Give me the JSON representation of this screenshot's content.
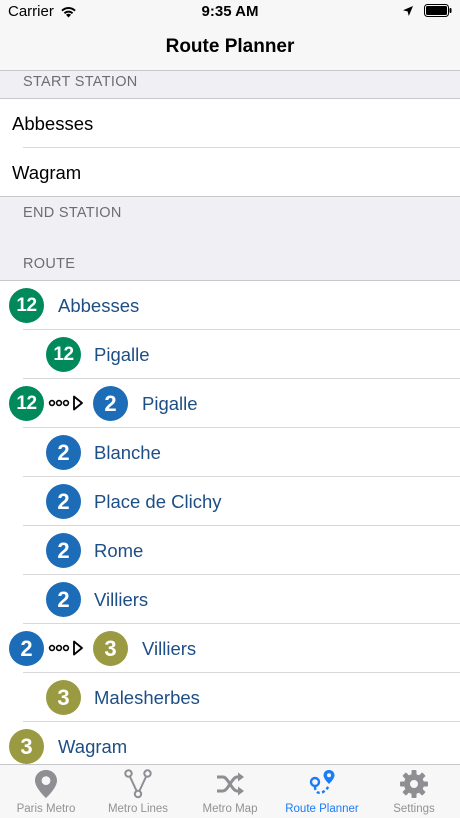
{
  "status_bar": {
    "carrier": "Carrier",
    "time": "9:35 AM"
  },
  "nav": {
    "title": "Route Planner"
  },
  "start_section": {
    "header": "START STATION",
    "stations": [
      "Abbesses",
      "Wagram"
    ]
  },
  "end_section": {
    "header": "END STATION"
  },
  "route_section": {
    "header": "ROUTE",
    "steps": [
      {
        "line": "12",
        "to_line": null,
        "station": "Abbesses"
      },
      {
        "line": "12",
        "to_line": null,
        "station": "Pigalle"
      },
      {
        "line": "12",
        "to_line": "2",
        "station": "Pigalle"
      },
      {
        "line": "2",
        "to_line": null,
        "station": "Blanche"
      },
      {
        "line": "2",
        "to_line": null,
        "station": "Place de Clichy"
      },
      {
        "line": "2",
        "to_line": null,
        "station": "Rome"
      },
      {
        "line": "2",
        "to_line": null,
        "station": "Villiers"
      },
      {
        "line": "2",
        "to_line": "3",
        "station": "Villiers"
      },
      {
        "line": "3",
        "to_line": null,
        "station": "Malesherbes"
      },
      {
        "line": "3",
        "to_line": null,
        "station": "Wagram"
      }
    ]
  },
  "line_colors": {
    "12": "#00895a",
    "2": "#1c6cb8",
    "3": "#9a9a42"
  },
  "colors": {
    "accent": "#1a7cf6",
    "route_text": "#1d4e85"
  },
  "tabs": [
    {
      "label": "Paris Metro",
      "icon": "map-pin-icon",
      "active": false
    },
    {
      "label": "Metro Lines",
      "icon": "lines-icon",
      "active": false
    },
    {
      "label": "Metro Map",
      "icon": "shuffle-icon",
      "active": false
    },
    {
      "label": "Route Planner",
      "icon": "route-icon",
      "active": true
    },
    {
      "label": "Settings",
      "icon": "gear-icon",
      "active": false
    }
  ]
}
